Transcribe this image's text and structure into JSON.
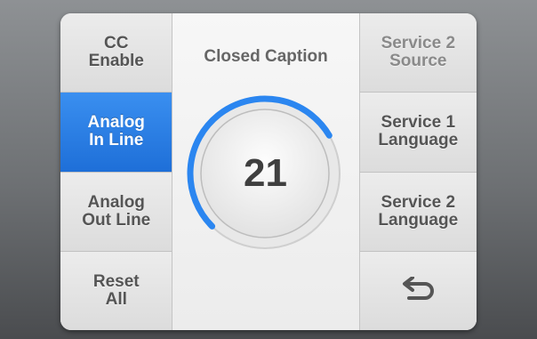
{
  "left_menu": {
    "items": [
      {
        "label": "CC\nEnable",
        "active": false
      },
      {
        "label": "Analog\nIn Line",
        "active": true
      },
      {
        "label": "Analog\nOut Line",
        "active": false
      },
      {
        "label": "Reset\nAll",
        "active": false
      }
    ]
  },
  "center": {
    "title": "Closed Caption",
    "value": "21",
    "level_fraction": 0.72,
    "accent_color": "#2b86f0"
  },
  "right_menu": {
    "items": [
      {
        "label": "Service 2\nSource",
        "dim": true
      },
      {
        "label": "Service 1\nLanguage",
        "dim": false
      },
      {
        "label": "Service 2\nLanguage",
        "dim": false
      }
    ],
    "back_icon": "return-arrow-icon"
  }
}
